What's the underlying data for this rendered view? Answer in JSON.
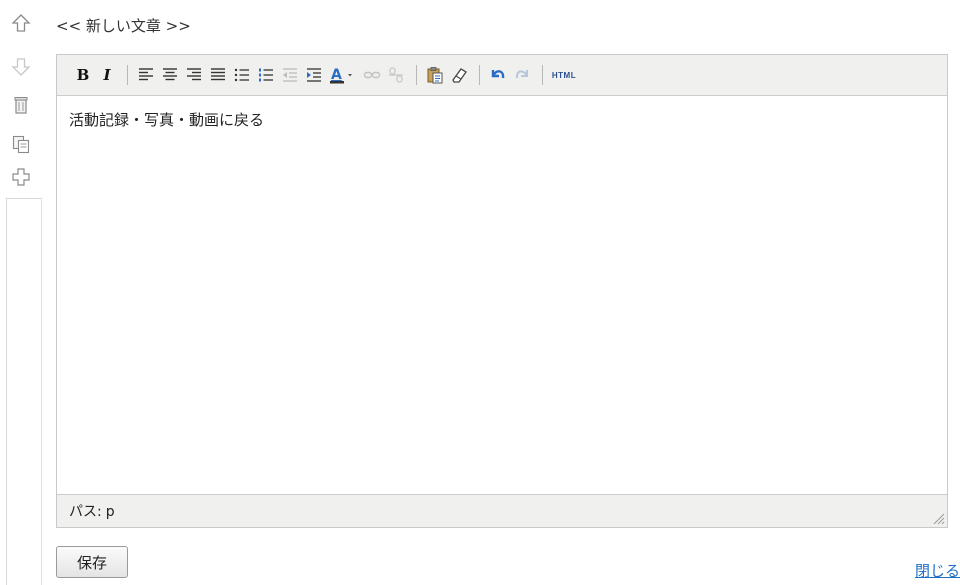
{
  "header": {
    "title": "<< 新しい文章 >>"
  },
  "side_actions": [
    {
      "icon": "arrow-up-icon"
    },
    {
      "icon": "arrow-down-icon"
    },
    {
      "icon": "trash-icon"
    },
    {
      "icon": "copy-icon"
    },
    {
      "icon": "plus-icon"
    }
  ],
  "toolbar": {
    "bold_label": "B",
    "italic_label": "I",
    "html_label": "HTML"
  },
  "editor": {
    "content": "活動記録・写真・動画に戻る"
  },
  "statusbar": {
    "path_label": "パス:",
    "path_value": "p"
  },
  "footer": {
    "save_label": "保存",
    "close_label": "閉じる"
  },
  "colors": {
    "toolbar_bg": "#f0f0ee",
    "border": "#cccccc",
    "link": "#1f6fc5",
    "icon_active": "#2b6cc4",
    "icon_disabled": "#bfbfbf"
  }
}
